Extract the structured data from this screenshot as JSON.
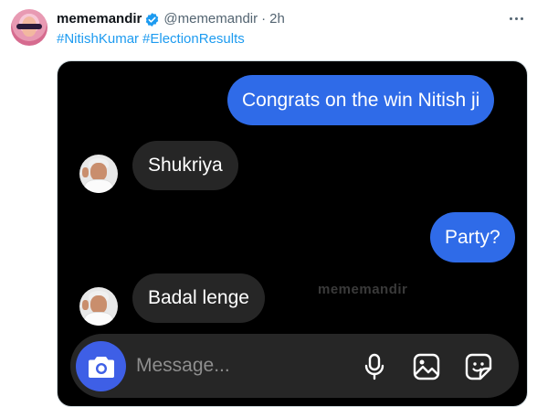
{
  "tweet": {
    "display_name": "mememandir",
    "handle": "@mememandir",
    "separator": "·",
    "time": "2h",
    "hashtags": [
      "#NitishKumar",
      "#ElectionResults"
    ]
  },
  "chat": {
    "messages": [
      {
        "from": "me",
        "text": "Congrats on the win Nitish ji"
      },
      {
        "from": "them",
        "text": "Shukriya"
      },
      {
        "from": "me",
        "text": "Party?"
      },
      {
        "from": "them",
        "text": "Badal lenge"
      }
    ],
    "watermark": "mememandir",
    "input_placeholder": "Message..."
  },
  "colors": {
    "link": "#1d9bf0",
    "verified": "#1d9bf0",
    "outgoing_bubble": "#2f6be8",
    "incoming_bubble": "#262626",
    "camera_button": "#3e5fe6",
    "chat_background": "#000000"
  },
  "icons": [
    "verified-badge-icon",
    "more-icon",
    "camera-icon",
    "microphone-icon",
    "gallery-icon",
    "sticker-icon"
  ]
}
